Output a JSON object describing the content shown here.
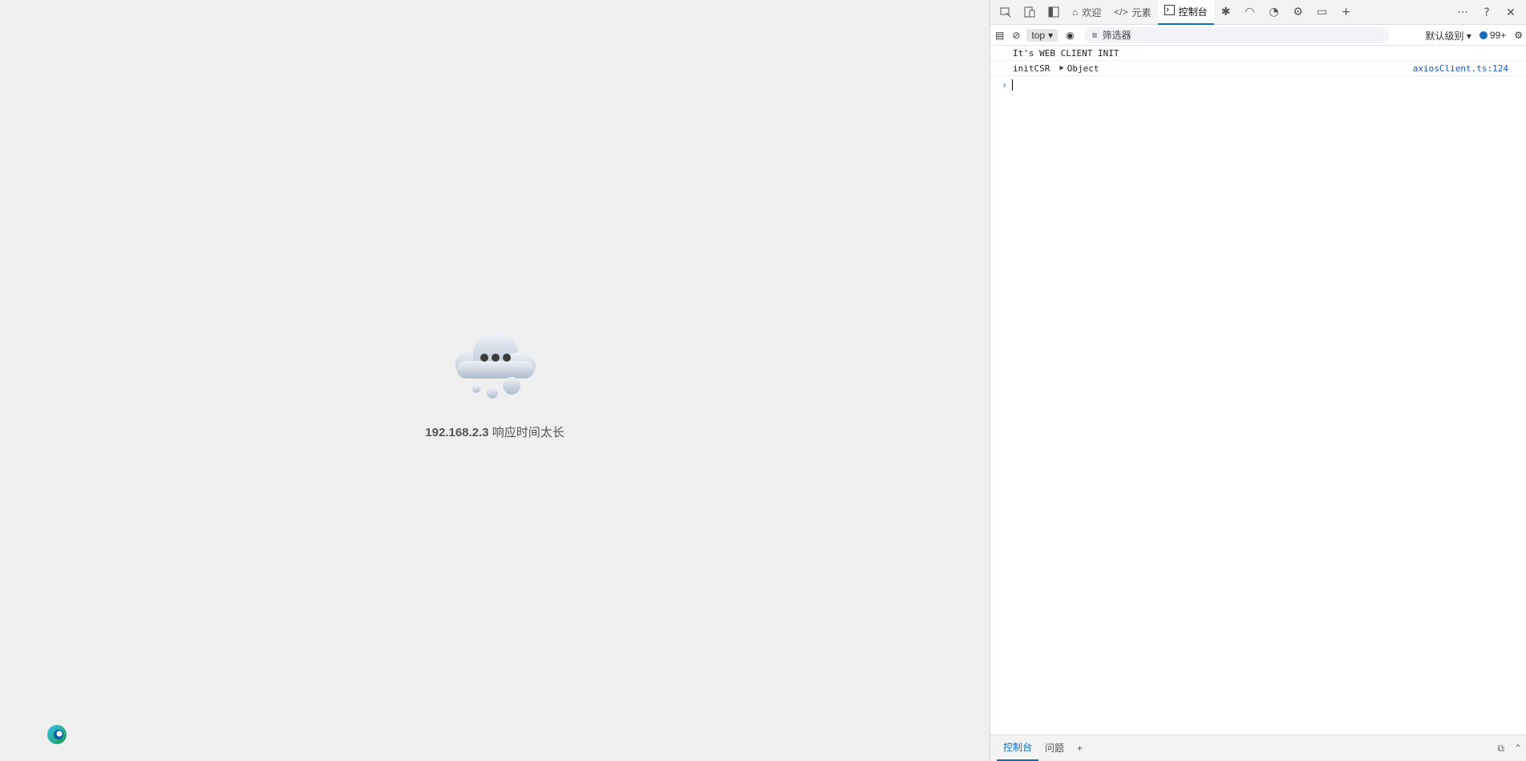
{
  "error_page": {
    "host": "192.168.2.3",
    "message": " 响应时间太长",
    "icon": "cloud-loading-icon",
    "browser_logo": "edge-logo"
  },
  "devtools": {
    "tabs": [
      {
        "label": "欢迎",
        "icon": "home-icon"
      },
      {
        "label": "元素",
        "icon": "code-icon"
      },
      {
        "label": "控制台",
        "icon": "console-icon",
        "active": true
      }
    ],
    "toolbar": {
      "context": "top",
      "filter_placeholder": "筛选器",
      "log_level": "默认级别",
      "issues_count": "99+"
    },
    "console_lines": [
      {
        "text": "It's WEB CLIENT INIT",
        "source": ""
      },
      {
        "label": "initCSR",
        "object": "Object",
        "source": "axiosClient.ts:124"
      }
    ],
    "drawer_tabs": [
      {
        "label": "控制台",
        "active": true
      },
      {
        "label": "问题"
      }
    ],
    "colors": {
      "accent": "#0f6cbd",
      "link": "#1a55b5"
    }
  }
}
